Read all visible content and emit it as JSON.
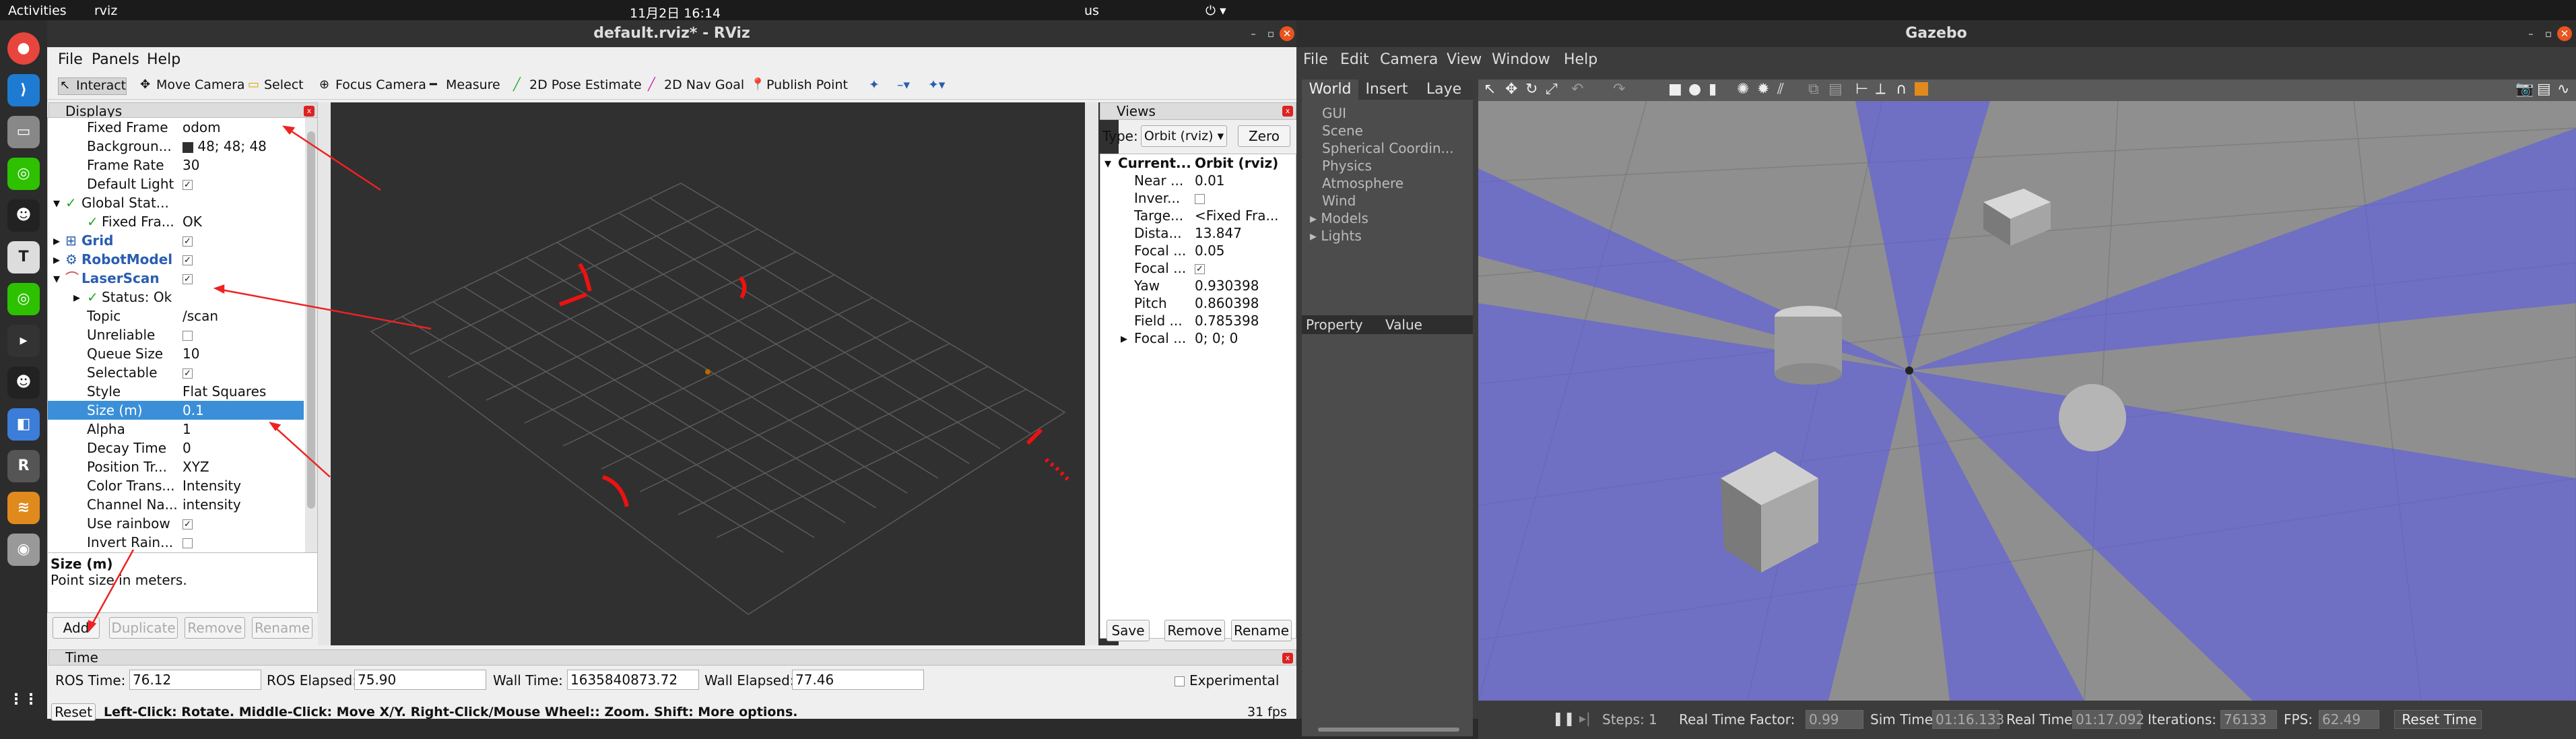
{
  "topbar": {
    "activities": "Activities",
    "app": "rviz",
    "datetime": "11月2日 16:14",
    "input": "us"
  },
  "dock": [
    "chrome-icon",
    "vscode-icon",
    "files-icon",
    "wechat-icon",
    "qq-icon",
    "typora-icon",
    "wechat-icon",
    "terminal-icon",
    "qq-icon",
    "app-icon",
    "rviz-icon",
    "layers-icon",
    "disk-icon",
    "apps-grid-icon"
  ],
  "rviz": {
    "title": "default.rviz* - RViz",
    "menu": [
      "File",
      "Panels",
      "Help"
    ],
    "tools": [
      "Interact",
      "Move Camera",
      "Select",
      "Focus Camera",
      "Measure",
      "2D Pose Estimate",
      "2D Nav Goal",
      "Publish Point"
    ],
    "displays_title": "Displays",
    "rows": [
      {
        "name": "Fixed Frame",
        "value": "odom"
      },
      {
        "name": "Backgroun...",
        "value": "48; 48; 48"
      },
      {
        "name": "Frame Rate",
        "value": "30"
      },
      {
        "name": "Default Light",
        "value": "✓"
      },
      {
        "name": "Global Stat...",
        "value": ""
      },
      {
        "name": "Fixed Fra...",
        "value": "OK"
      },
      {
        "name": "Grid",
        "value": "✓"
      },
      {
        "name": "RobotModel",
        "value": "✓"
      },
      {
        "name": "LaserScan",
        "value": "✓"
      },
      {
        "name": "Status: Ok",
        "value": ""
      },
      {
        "name": "Topic",
        "value": "/scan"
      },
      {
        "name": "Unreliable",
        "value": ""
      },
      {
        "name": "Queue Size",
        "value": "10"
      },
      {
        "name": "Selectable",
        "value": "✓"
      },
      {
        "name": "Style",
        "value": "Flat Squares"
      },
      {
        "name": "Size (m)",
        "value": "0.1"
      },
      {
        "name": "Alpha",
        "value": "1"
      },
      {
        "name": "Decay Time",
        "value": "0"
      },
      {
        "name": "Position Tr...",
        "value": "XYZ"
      },
      {
        "name": "Color Trans...",
        "value": "Intensity"
      },
      {
        "name": "Channel Na...",
        "value": "intensity"
      },
      {
        "name": "Use rainbow",
        "value": "✓"
      },
      {
        "name": "Invert Rain...",
        "value": ""
      }
    ],
    "desc_title": "Size (m)",
    "desc_text": "Point size in meters.",
    "buttons": [
      "Add",
      "Duplicate",
      "Remove",
      "Rename"
    ],
    "views": {
      "title": "Views",
      "type_label": "Type:",
      "type_value": "Orbit (rviz)",
      "zero": "Zero",
      "rows": [
        {
          "name": "Current...",
          "value": "Orbit (rviz)"
        },
        {
          "name": "Near ...",
          "value": "0.01"
        },
        {
          "name": "Inver...",
          "value": ""
        },
        {
          "name": "Targe...",
          "value": "<Fixed Fra..."
        },
        {
          "name": "Dista...",
          "value": "13.847"
        },
        {
          "name": "Focal ...",
          "value": "0.05"
        },
        {
          "name": "Focal ...",
          "value": "✓"
        },
        {
          "name": "Yaw",
          "value": "0.930398"
        },
        {
          "name": "Pitch",
          "value": "0.860398"
        },
        {
          "name": "Field ...",
          "value": "0.785398"
        },
        {
          "name": "Focal ...",
          "value": "0; 0; 0"
        }
      ],
      "buttons": [
        "Save",
        "Remove",
        "Rename"
      ]
    },
    "time": {
      "title": "Time",
      "ros_time_label": "ROS Time:",
      "ros_time": "76.12",
      "ros_elapsed_label": "ROS Elapsed:",
      "ros_elapsed": "75.90",
      "wall_time_label": "Wall Time:",
      "wall_time": "1635840873.72",
      "wall_elapsed_label": "Wall Elapsed:",
      "wall_elapsed": "77.46",
      "experimental": "Experimental"
    },
    "status": {
      "reset": "Reset",
      "hint": "Left-Click: Rotate. Middle-Click: Move X/Y. Right-Click/Mouse Wheel:: Zoom. Shift: More options.",
      "fps": "31 fps"
    }
  },
  "gazebo": {
    "title": "Gazebo",
    "menu": [
      "File",
      "Edit",
      "Camera",
      "View",
      "Window",
      "Help"
    ],
    "tabs": [
      "World",
      "Insert",
      "Laye"
    ],
    "world_items": [
      "GUI",
      "Scene",
      "Spherical Coordin...",
      "Physics",
      "Atmosphere",
      "Wind",
      "Models",
      "Lights"
    ],
    "prop_headers": [
      "Property",
      "Value"
    ],
    "status": {
      "steps": "Steps: 1",
      "rtf_label": "Real Time Factor:",
      "rtf": "0.99",
      "sim_label": "Sim Time:",
      "sim": "01:16.133",
      "real_label": "Real Time:",
      "real": "01:17.092",
      "iter_label": "Iterations:",
      "iter": "76133",
      "fps_label": "FPS:",
      "fps": "62.49",
      "reset": "Reset Time"
    }
  }
}
